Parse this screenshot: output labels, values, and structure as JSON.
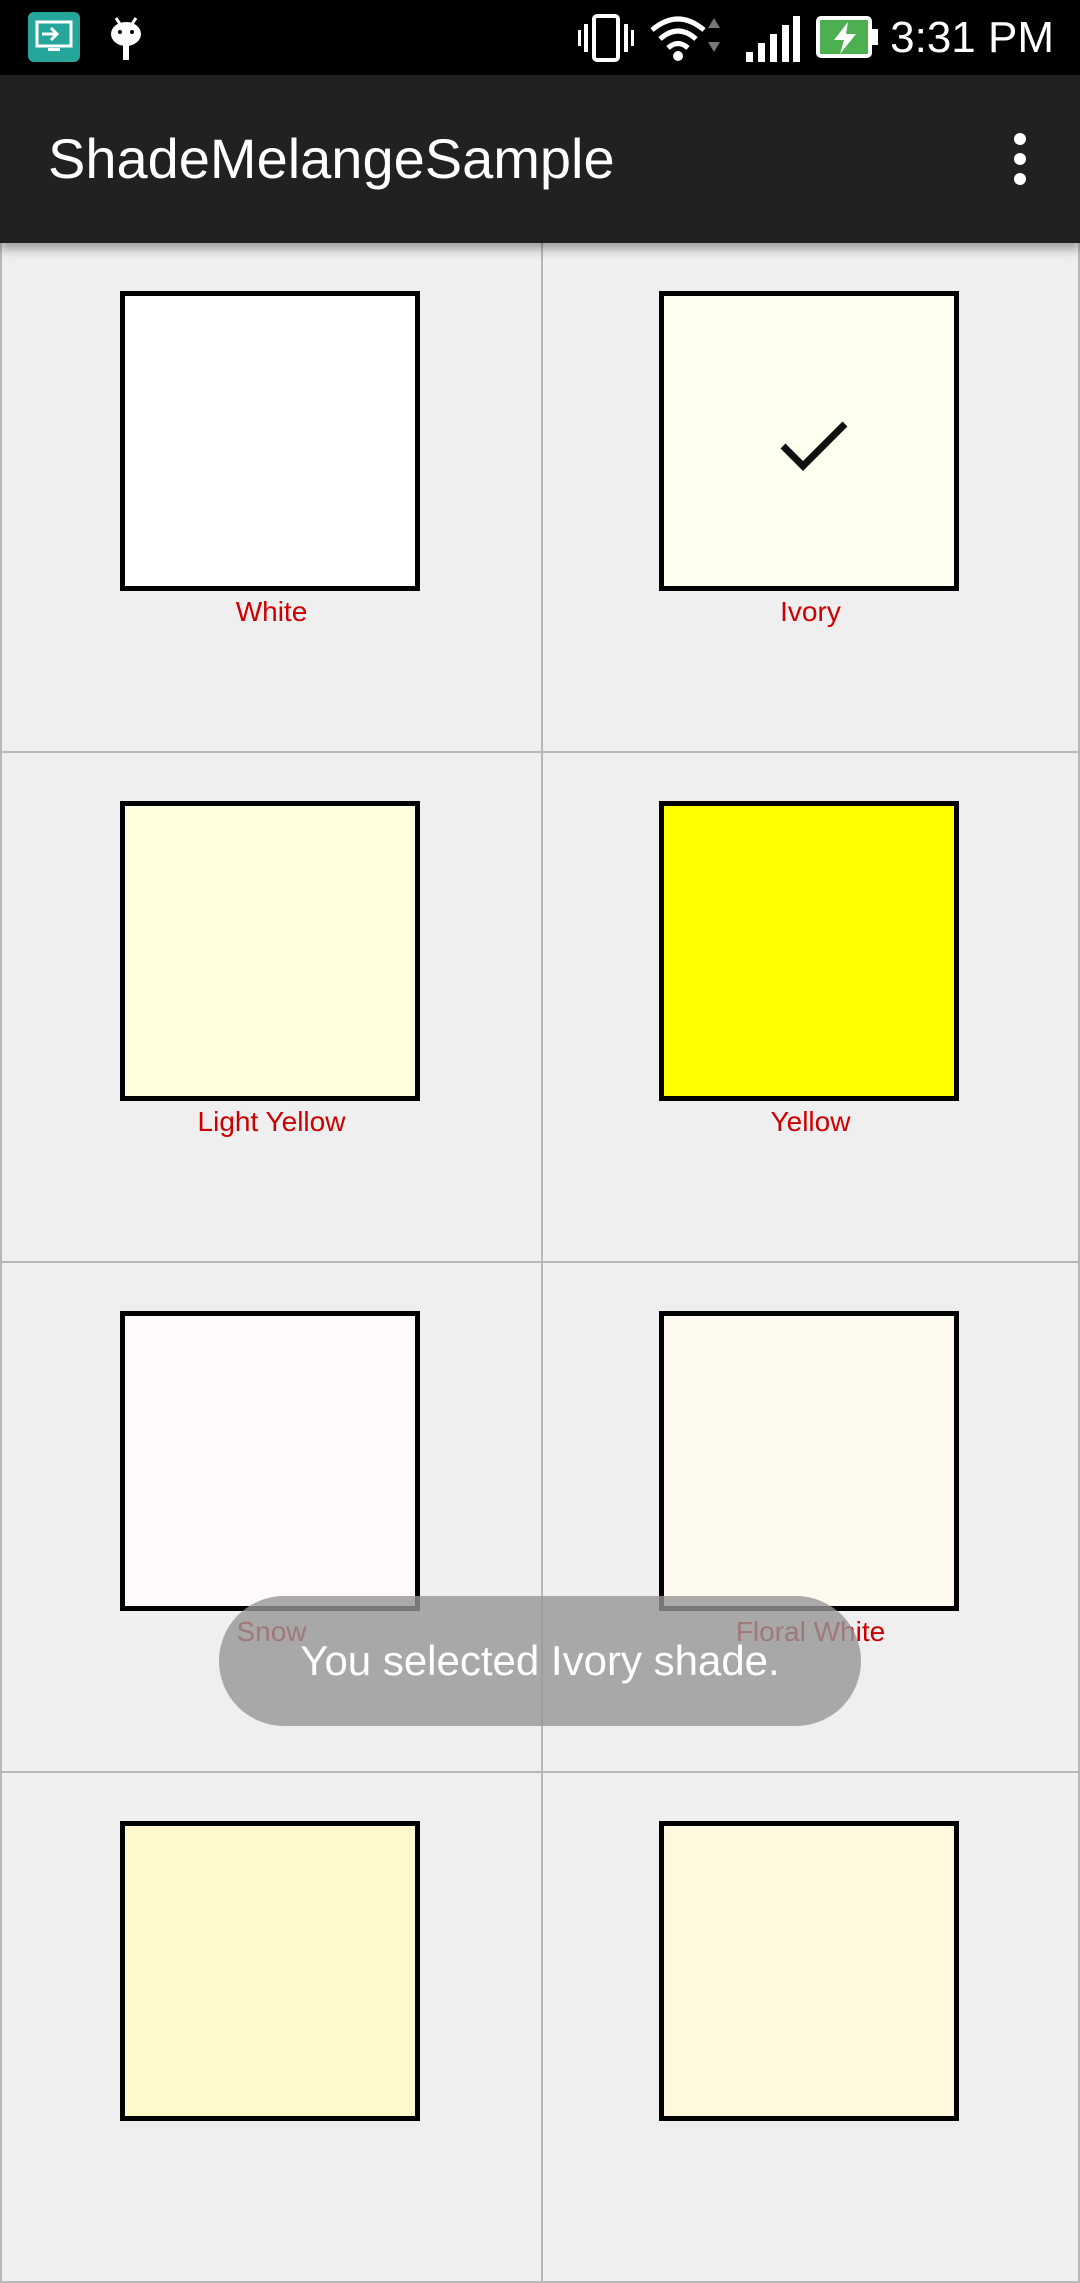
{
  "status_bar": {
    "time": "3:31 PM",
    "icons": [
      "screen-cast-icon",
      "android-debug-icon",
      "vibrate-icon",
      "wifi-icon",
      "signal-icon",
      "battery-charging-icon"
    ]
  },
  "app_bar": {
    "title": "ShadeMelangeSample",
    "menu_icon": "overflow-menu-icon"
  },
  "shades": [
    {
      "name": "White",
      "color": "#ffffff",
      "selected": false
    },
    {
      "name": "Ivory",
      "color": "#fffff0",
      "selected": true
    },
    {
      "name": "Light Yellow",
      "color": "#ffffe0",
      "selected": false
    },
    {
      "name": "Yellow",
      "color": "#ffff00",
      "selected": false
    },
    {
      "name": "Snow",
      "color": "#fffafa",
      "selected": false
    },
    {
      "name": "Floral White",
      "color": "#fffaf0",
      "selected": false
    },
    {
      "name": "",
      "color": "#fff8cc",
      "selected": false
    },
    {
      "name": "",
      "color": "#fff8dc",
      "selected": false
    }
  ],
  "toast": {
    "message": "You selected Ivory  shade."
  },
  "colors": {
    "label": "#cc0000",
    "app_bar": "#212121",
    "grid_background": "#efefef"
  }
}
